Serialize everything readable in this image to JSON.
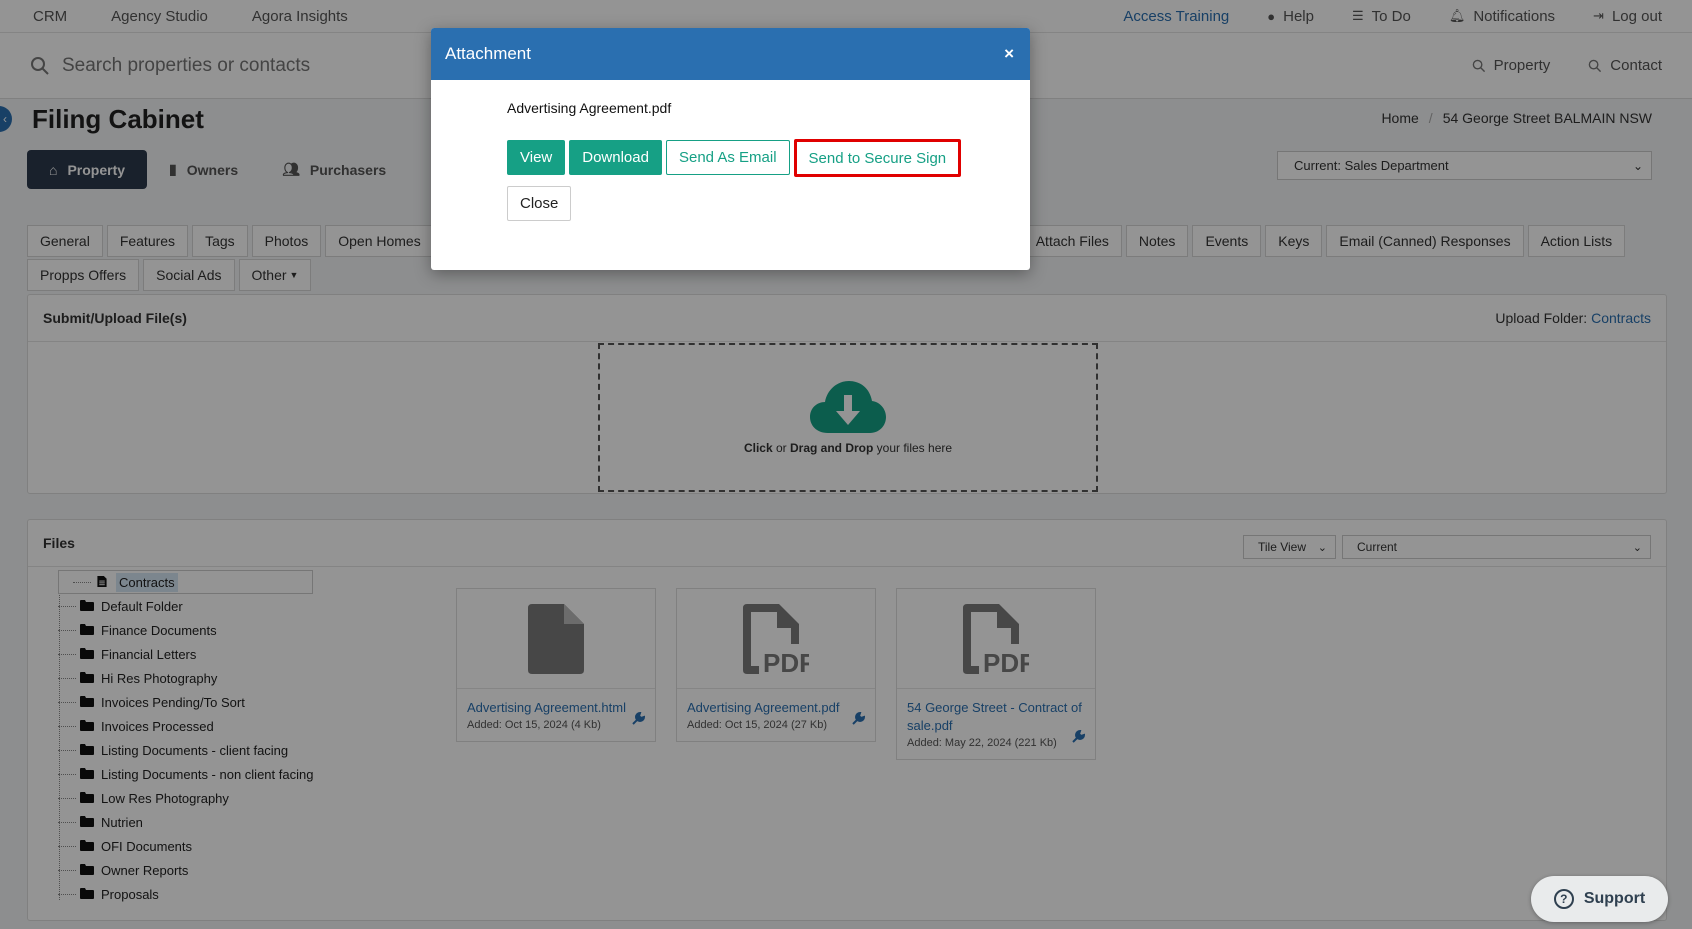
{
  "topnav": {
    "left": [
      "CRM",
      "Agency Studio",
      "Agora Insights"
    ],
    "access_training": "Access Training",
    "help": "Help",
    "todo": "To Do",
    "notifications": "Notifications",
    "logout": "Log out"
  },
  "search": {
    "placeholder": "Search properties or contacts",
    "quick_property": "Property",
    "quick_contact": "Contact"
  },
  "page": {
    "title": "Filing Cabinet",
    "breadcrumb_home": "Home",
    "breadcrumb_current": "54 George Street BALMAIN NSW",
    "department": "Current: Sales Department"
  },
  "main_tabs": [
    "Property",
    "Owners",
    "Purchasers"
  ],
  "sub_tabs_row1": [
    "General",
    "Features",
    "Tags",
    "Photos",
    "Open Homes",
    "Attach Files",
    "Notes",
    "Events",
    "Keys",
    "Email (Canned) Responses",
    "Action Lists"
  ],
  "sub_tabs_row2": [
    "Propps Offers",
    "Social Ads",
    "Other"
  ],
  "upload": {
    "title": "Submit/Upload File(s)",
    "folder_label": "Upload Folder:",
    "folder_value": "Contracts",
    "drop_click": "Click",
    "drop_or": " or ",
    "drop_drag": "Drag and Drop",
    "drop_rest": " your files here"
  },
  "files": {
    "title": "Files",
    "view": "Tile View",
    "filter": "Current",
    "folders": [
      "Contracts",
      "Default Folder",
      "Finance Documents",
      "Financial Letters",
      "Hi Res Photography",
      "Invoices Pending/To Sort",
      "Invoices Processed",
      "Listing Documents - client facing",
      "Listing Documents - non client facing",
      "Low Res Photography",
      "Nutrien",
      "OFI Documents",
      "Owner Reports",
      "Proposals"
    ],
    "tiles": [
      {
        "name": "Advertising Agreement.html",
        "added": "Added: Oct 15, 2024 (4 Kb)"
      },
      {
        "name": "Advertising Agreement.pdf",
        "added": "Added: Oct 15, 2024 (27 Kb)"
      },
      {
        "name": "54 George Street - Contract of sale.pdf",
        "added": "Added: May 22, 2024 (221 Kb)"
      }
    ]
  },
  "modal": {
    "title": "Attachment",
    "close_x": "×",
    "filename": "Advertising Agreement.pdf",
    "view": "View",
    "download": "Download",
    "send_email": "Send As Email",
    "secure_sign": "Send to Secure Sign",
    "close": "Close"
  },
  "support": "Support",
  "colors": {
    "accent": "#2a6fb0",
    "green": "#16a085",
    "highlight": "#e00000"
  }
}
